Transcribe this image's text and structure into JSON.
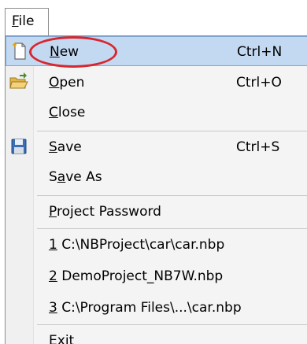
{
  "menubar": {
    "file_tab": {
      "label_mn": "F",
      "label_rest": "ile"
    }
  },
  "menu": {
    "new": {
      "mn": "N",
      "rest": "ew",
      "shortcut": "Ctrl+N"
    },
    "open": {
      "mn": "O",
      "rest": "pen",
      "shortcut": "Ctrl+O"
    },
    "close": {
      "mn": "C",
      "rest": "lose"
    },
    "save": {
      "mn": "S",
      "rest": "ave",
      "shortcut": "Ctrl+S"
    },
    "save_as": {
      "pre": "S",
      "mn": "a",
      "rest": "ve As"
    },
    "project_password": {
      "mn": "P",
      "rest": "roject Password"
    },
    "recent_1": {
      "mn": "1",
      "rest": " C:\\NBProject\\car\\car.nbp"
    },
    "recent_2": {
      "mn": "2",
      "rest": " DemoProject_NB7W.nbp"
    },
    "recent_3": {
      "mn": "3",
      "rest": " C:\\Program Files\\...\\car.nbp"
    },
    "exit": {
      "pre": "E",
      "mn": "x",
      "rest": "it"
    }
  },
  "colors": {
    "highlight": "#c3d9f2",
    "highlight_border": "#7ea6d8",
    "annotation_oval": "#d7262e"
  },
  "icons": {
    "new": "new-document-icon",
    "open": "open-folder-icon",
    "save": "save-disk-icon"
  }
}
